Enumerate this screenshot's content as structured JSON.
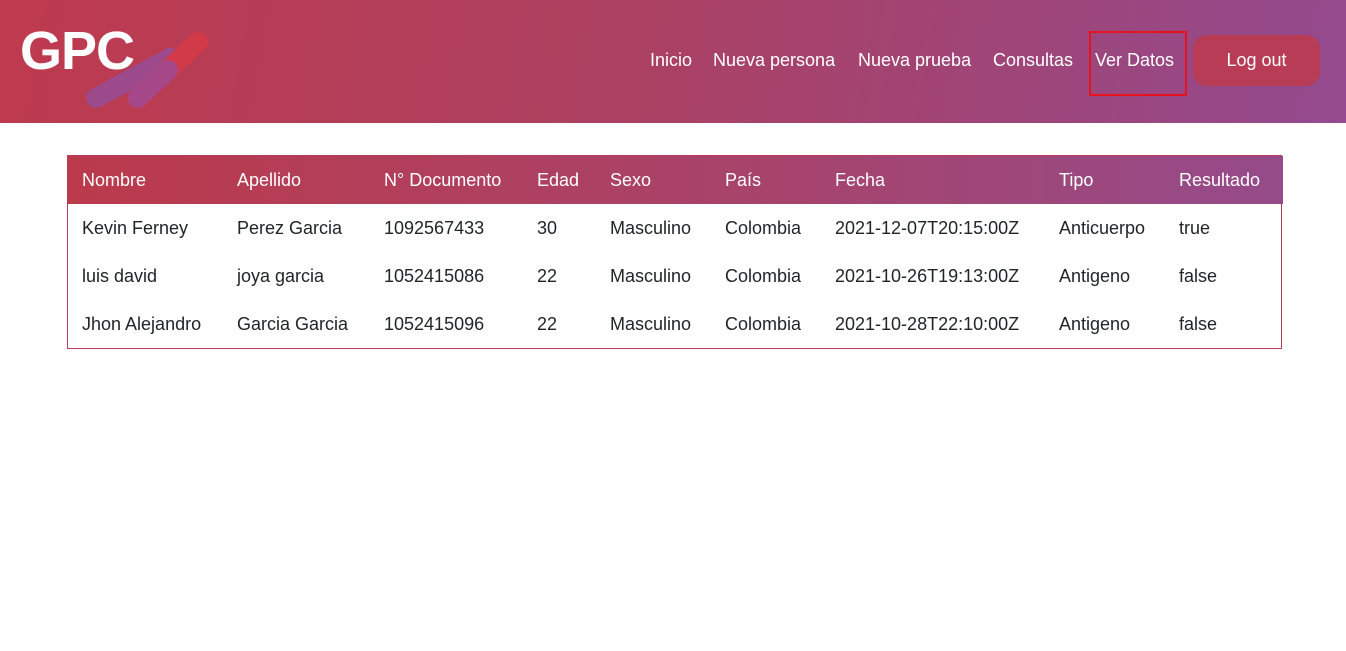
{
  "brand": {
    "logo_text": "GPC"
  },
  "nav": {
    "items": [
      "Inicio",
      "Nueva persona",
      "Nueva prueba",
      "Consultas",
      "Ver Datos"
    ],
    "active": "Ver Datos",
    "logout_label": "Log out"
  },
  "colors": {
    "header_gradient_start": "#be3a4e",
    "header_gradient_end": "#934a8e",
    "logout_bg": "#b83c55",
    "active_outline": "#e8121c"
  },
  "table": {
    "headers": [
      "Nombre",
      "Apellido",
      "N° Documento",
      "Edad",
      "Sexo",
      "País",
      "Fecha",
      "Tipo",
      "Resultado"
    ],
    "rows": [
      [
        "Kevin Ferney",
        "Perez Garcia",
        "1092567433",
        "30",
        "Masculino",
        "Colombia",
        "2021-12-07T20:15:00Z",
        "Anticuerpo",
        "true"
      ],
      [
        "luis david",
        "joya garcia",
        "1052415086",
        "22",
        "Masculino",
        "Colombia",
        "2021-10-26T19:13:00Z",
        "Antigeno",
        "false"
      ],
      [
        "Jhon Alejandro",
        "Garcia Garcia",
        "1052415096",
        "22",
        "Masculino",
        "Colombia",
        "2021-10-28T22:10:00Z",
        "Antigeno",
        "false"
      ]
    ]
  }
}
